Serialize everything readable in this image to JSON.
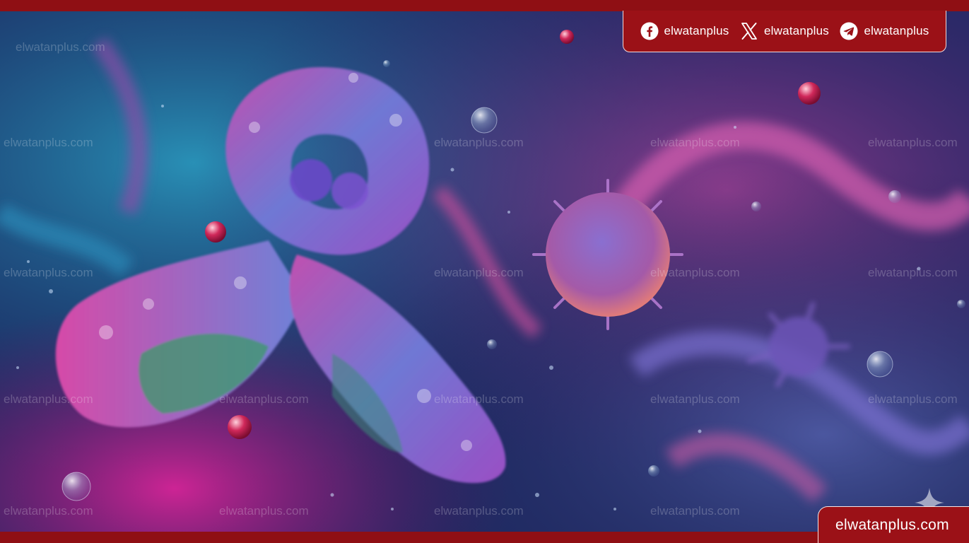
{
  "social": {
    "facebook": {
      "icon": "facebook-icon",
      "handle": "elwatanplus"
    },
    "x": {
      "icon": "x-icon",
      "handle": "elwatanplus"
    },
    "telegram": {
      "icon": "telegram-icon",
      "handle": "elwatanplus"
    }
  },
  "watermark": {
    "text": "elwatanplus.com"
  },
  "brand": {
    "site": "elwatanplus.com"
  },
  "colors": {
    "brand_red": "#9b1117",
    "bar_red": "#8f0f14"
  }
}
